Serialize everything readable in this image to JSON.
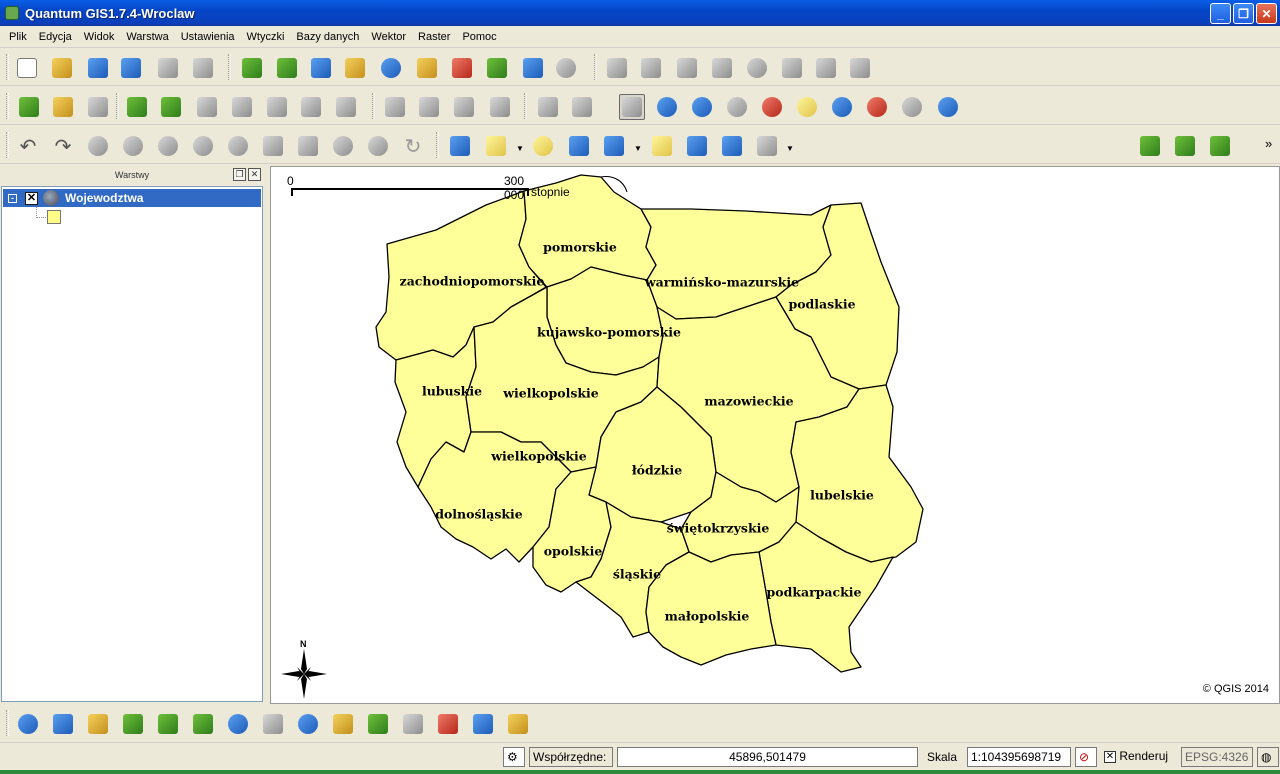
{
  "window": {
    "title": "Quantum GIS1.7.4-Wroclaw"
  },
  "menu": [
    "Plik",
    "Edycja",
    "Widok",
    "Warstwa",
    "Ustawienia",
    "Wtyczki",
    "Bazy danych",
    "Wektor",
    "Raster",
    "Pomoc"
  ],
  "layers_panel": {
    "title": "Warstwy",
    "layer_name": "Wojewodztwa",
    "layer_checked_glyph": "✕",
    "expand_glyph": "-"
  },
  "map": {
    "scalebar": {
      "start": "0",
      "end": "300 000",
      "unit": "stopnie"
    },
    "north_label": "N",
    "copyright": "© QGIS 2014",
    "fill_color": "#ffff99",
    "regions": [
      "zachodniopomorskie",
      "pomorskie",
      "warmińsko-mazurskie",
      "podlaskie",
      "kujawsko-pomorskie",
      "lubuskie",
      "wielkopolskie",
      "mazowieckie",
      "wielkopolskie",
      "łódzkie",
      "lubelskie",
      "dolnośląskie",
      "świętokrzyskie",
      "opolskie",
      "śląskie",
      "podkarpackie",
      "małopolskie"
    ]
  },
  "status": {
    "coords_label": "Współrzędne:",
    "coords_value": "45896,501479",
    "scale_label": "Skala",
    "scale_value": "1:104395698719",
    "render_label": "Renderuj",
    "render_checked_glyph": "✕",
    "crs": "EPSG:4326"
  }
}
